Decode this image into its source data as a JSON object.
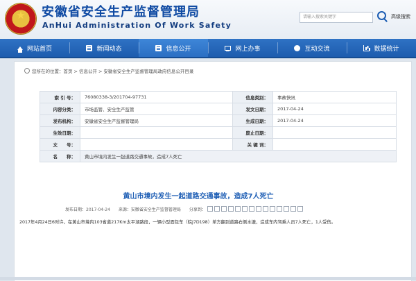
{
  "header": {
    "title_cn": "安徽省安全生产监督管理局",
    "title_en": "AnHui Administration Of Work Safety",
    "search_placeholder": "请输入搜索关键字",
    "advanced_search": "高级搜索"
  },
  "nav": {
    "items": [
      {
        "label": "网站首页",
        "icon": "home-icon"
      },
      {
        "label": "新闻动态",
        "icon": "document-icon"
      },
      {
        "label": "信息公开",
        "icon": "document-icon"
      },
      {
        "label": "网上办事",
        "icon": "monitor-icon"
      },
      {
        "label": "互动交流",
        "icon": "chat-icon"
      },
      {
        "label": "数据统计",
        "icon": "chart-icon"
      }
    ],
    "active_index": 2
  },
  "breadcrumb": {
    "prefix": "您所在的位置：",
    "items": [
      "首页",
      "信息公开",
      "安徽省安全生产监督管理局政府信息公开目录"
    ]
  },
  "info_table": {
    "rows": [
      {
        "label1": "索 引 号：",
        "value1": "76080338-3/201704-97731",
        "label2": "信息类别：",
        "value2": "事故快讯"
      },
      {
        "label1": "内容分类：",
        "value1": "市场监管、安全生产监管",
        "label2": "发文日期：",
        "value2": "2017-04-24"
      },
      {
        "label1": "发布机构：",
        "value1": "安徽省安全生产监督管理局",
        "label2": "生成日期：",
        "value2": "2017-04-24"
      },
      {
        "label1": "生效日期：",
        "value1": "",
        "label2": "废止日期：",
        "value2": ""
      },
      {
        "label1": "文　　号：",
        "value1": "",
        "label2": "关 键 词：",
        "value2": ""
      }
    ],
    "name_label": "名　　称：",
    "name_value": "黄山市境内发生一起道路交通事故，造成7人死亡"
  },
  "article": {
    "title": "黄山市境内发生一起道路交通事故，造成7人死亡",
    "meta_date_label": "发布日期：",
    "meta_date": "2017-04-24",
    "meta_source_label": "来源：",
    "meta_source": "安徽省安全生产监督管理局",
    "meta_share_label": "分享到：",
    "body": "2017年4月24日6时许，在黄山市境内103省道217Km太平湖路段，一辆小型面包车（皖J7D198）单方翻到道路右侧水塘，造成车内驾乘人员7人死亡，1人受伤。"
  },
  "colors": {
    "brand_blue": "#1d5cae",
    "title_blue": "#0f4aa3",
    "article_title": "#1f5fb5"
  }
}
